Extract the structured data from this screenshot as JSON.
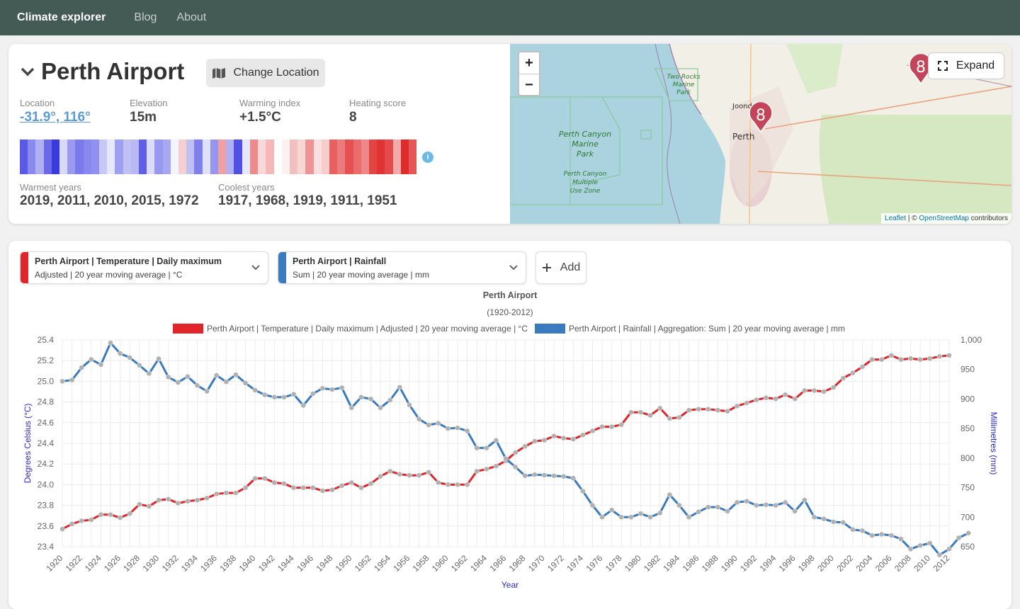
{
  "nav": {
    "brand": "Climate explorer",
    "links": [
      "Blog",
      "About"
    ]
  },
  "site": {
    "title": "Perth Airport",
    "change_location_label": "Change Location",
    "location_label": "Location",
    "location_value": "-31.9°, 116°",
    "elevation_label": "Elevation",
    "elevation_value": "15m",
    "warming_label": "Warming index",
    "warming_value": "+1.5°C",
    "heating_label": "Heating score",
    "heating_value": "8",
    "warmest_label": "Warmest years",
    "warmest_value": "2019, 2011, 2010, 2015, 1972",
    "coolest_label": "Coolest years",
    "coolest_value": "1917, 1968, 1919, 1911, 1951",
    "info_icon": "i"
  },
  "stripes": [
    "#5a5ae6",
    "#8a8aee",
    "#b0b0f2",
    "#6a6ae8",
    "#3a3ae0",
    "#d8d8f8",
    "#9a9af0",
    "#7a7aec",
    "#8888ee",
    "#9090f0",
    "#c8c8f6",
    "#e8e8fc",
    "#a0a0f0",
    "#c0c0f4",
    "#b8b8f4",
    "#6060e6",
    "#dcdcfa",
    "#9898f0",
    "#a8a8f2",
    "#f4f4fe",
    "#f6d0d0",
    "#c0c0f4",
    "#8080ec",
    "#e0e0fa",
    "#9696f0",
    "#f0a0a0",
    "#b0b0f2",
    "#5050e2",
    "#e6e6fc",
    "#ee8a8a",
    "#f8d8d8",
    "#f4b8b8",
    "#ffffff",
    "#fdf0f0",
    "#f3c0c0",
    "#f7d6d6",
    "#ef9494",
    "#f9e0e0",
    "#f6cccc",
    "#e86060",
    "#ec7c7c",
    "#e55050",
    "#ea6c6c",
    "#ee8888",
    "#e34444",
    "#e03434",
    "#e44a4a",
    "#f2aaaa",
    "#de2c2c",
    "#e65656"
  ],
  "map": {
    "zoom_in": "+",
    "zoom_out": "−",
    "expand_label": "Expand",
    "cluster_count": "8",
    "cluster_count_2": "8",
    "labels": {
      "park1": "Perth Canyon Marine Park",
      "park2": "Perth Canyon Multiple Use Zone",
      "park3": "Two Rocks Marine Park",
      "city": "Perth",
      "suburb": "Joondalup"
    },
    "attrib_leaflet": "Leaflet",
    "attrib_sep": " | © ",
    "attrib_osm": "OpenStreetMap",
    "attrib_tail": " contributors"
  },
  "selectors": [
    {
      "line1": "Perth Airport | Temperature | Daily maximum",
      "line2": "Adjusted | 20 year moving average | °C",
      "color": "#e0262b"
    },
    {
      "line1": "Perth Airport | Rainfall",
      "line2": "Sum | 20 year moving average | mm",
      "color": "#3a7bbf"
    }
  ],
  "add_label": "Add",
  "chart_data": {
    "type": "line",
    "title": "Perth Airport",
    "subtitle": "(1920-2012)",
    "xlabel": "Year",
    "ylabel_left": "Degrees Celsius (°C)",
    "ylabel_right": "Millimetres (mm)",
    "ylim_left": [
      23.4,
      25.4
    ],
    "ylim_right": [
      650,
      1000
    ],
    "xlim": [
      1920,
      2012
    ],
    "series": [
      {
        "name": "Perth Airport | Temperature | Daily maximum | Adjusted | 20 year moving average | °C",
        "color": "#e0262b",
        "axis": "left",
        "values": [
          23.57,
          23.62,
          23.65,
          23.66,
          23.71,
          23.71,
          23.68,
          23.72,
          23.81,
          23.79,
          23.85,
          23.86,
          23.82,
          23.84,
          23.85,
          23.87,
          23.91,
          23.92,
          23.92,
          23.97,
          24.06,
          24.06,
          24.02,
          24.01,
          23.97,
          23.97,
          23.97,
          23.94,
          23.95,
          23.99,
          24.02,
          23.97,
          24.01,
          24.08,
          24.13,
          24.1,
          24.09,
          24.09,
          24.12,
          24.02,
          24.0,
          24.0,
          24.0,
          24.13,
          24.15,
          24.18,
          24.23,
          24.31,
          24.37,
          24.42,
          24.43,
          24.47,
          24.45,
          24.44,
          24.48,
          24.52,
          24.56,
          24.56,
          24.58,
          24.7,
          24.7,
          24.67,
          24.74,
          24.64,
          24.65,
          24.72,
          24.73,
          24.73,
          24.72,
          24.71,
          24.76,
          24.79,
          24.82,
          24.84,
          24.83,
          24.87,
          24.83,
          24.91,
          24.91,
          24.9,
          24.94,
          25.03,
          25.08,
          25.14,
          25.21,
          25.21,
          25.25,
          25.21,
          25.22,
          25.21,
          25.22,
          25.24,
          25.25
        ]
      },
      {
        "name": "Perth Airport | Rainfall | Aggregation: Sum | 20 year moving average | mm",
        "color": "#3a7bbf",
        "axis": "right",
        "values": [
          930,
          932,
          953,
          967,
          958,
          995,
          977,
          970,
          957,
          943,
          968,
          937,
          928,
          938,
          923,
          913,
          940,
          929,
          941,
          927,
          915,
          907,
          903,
          903,
          908,
          889,
          909,
          918,
          916,
          919,
          885,
          903,
          900,
          885,
          898,
          920,
          890,
          866,
          856,
          859,
          850,
          851,
          846,
          817,
          817,
          830,
          799,
          785,
          770,
          772,
          771,
          770,
          769,
          766,
          744,
          720,
          700,
          712,
          700,
          700,
          706,
          700,
          707,
          738,
          720,
          700,
          709,
          717,
          717,
          710,
          725,
          727,
          720,
          721,
          720,
          725,
          710,
          729,
          700,
          697,
          692,
          691,
          679,
          677,
          669,
          671,
          669,
          663,
          646,
          652,
          656,
          636,
          646,
          665,
          673
        ]
      }
    ]
  }
}
